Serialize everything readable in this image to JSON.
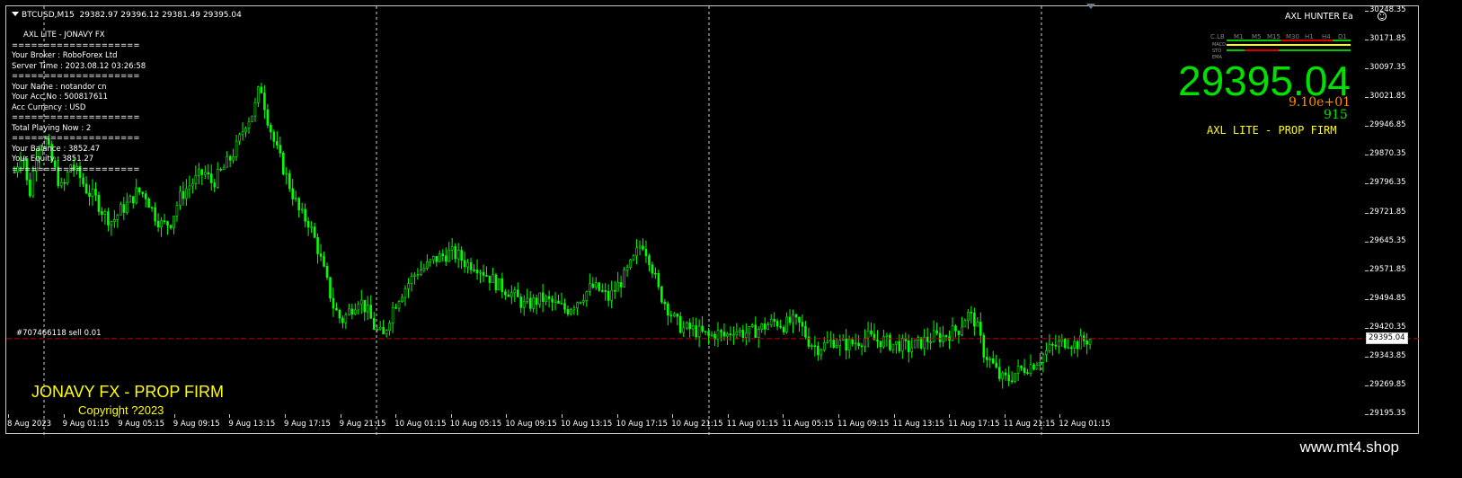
{
  "header": {
    "symbol_timeframe": "BTCUSD,M15",
    "ohlc": "29382.97 29396.12 29381.49 29395.04"
  },
  "info_panel": {
    "title": "AXL LITE - JONAVY FX",
    "separator": "====================",
    "broker": "Your Broker  : RoboForex Ltd",
    "server_time": "Server Time : 2023.08.12 03:26:58",
    "name": "Your Name    : notandor cn",
    "acc_no": "Your Acc.No  : 500817611",
    "currency": "Acc Currency : USD",
    "total_playing": "Total Playing Now : 2",
    "balance": "Your Balance : 3852.47",
    "equity": "Your Equity   : 3851.27"
  },
  "ea": {
    "name": "AXL HUNTER Ea",
    "big_price": "29395.04",
    "sci_value": "9.10e+01",
    "points": "915",
    "label": "AXL LITE  -  PROP FIRM",
    "colors": {
      "price": "#00e000",
      "sci": "#ff8c00",
      "points": "#00e000",
      "label": "#ffff00"
    }
  },
  "tf_panel": {
    "timeframes": [
      "C.LB",
      "M1",
      "M5",
      "M15",
      "M30",
      "H1",
      "H4",
      "D1"
    ],
    "rows": [
      "MACD",
      "STO",
      "EMA"
    ],
    "colors": {
      "up": "#00c800",
      "down": "#d40000",
      "neutral": "#ffff00"
    }
  },
  "order_line": {
    "label": "#707466118 sell 0.01",
    "price": "29395.04",
    "color": "#c80000"
  },
  "footer": {
    "brand": "JONAVY FX - PROP FIRM",
    "copyright": "Copyright ?2023"
  },
  "watermark": "www.mt4.shop",
  "y_axis": {
    "min": 29195.35,
    "max": 30248.35,
    "ticks": [
      "30248.35",
      "30171.85",
      "30097.35",
      "30021.85",
      "29946.85",
      "29870.35",
      "29796.35",
      "29721.85",
      "29645.35",
      "29571.85",
      "29494.85",
      "29420.35",
      "29343.85",
      "29269.85",
      "29195.35"
    ]
  },
  "x_axis": {
    "ticks": [
      "8 Aug 2023",
      "9 Aug 01:15",
      "9 Aug 05:15",
      "9 Aug 09:15",
      "9 Aug 13:15",
      "9 Aug 17:15",
      "9 Aug 21:15",
      "10 Aug 01:15",
      "10 Aug 05:15",
      "10 Aug 09:15",
      "10 Aug 13:15",
      "10 Aug 17:15",
      "10 Aug 21:15",
      "11 Aug 01:15",
      "11 Aug 05:15",
      "11 Aug 09:15",
      "11 Aug 13:15",
      "11 Aug 17:15",
      "11 Aug 21:15",
      "12 Aug 01:15"
    ],
    "day_separators": [
      "9 Aug",
      "10 Aug",
      "11 Aug",
      "12 Aug"
    ]
  },
  "chart_data": {
    "type": "candlestick",
    "symbol": "BTCUSD",
    "timeframe": "M15",
    "candle_color": "#00ff00",
    "grid": false,
    "ylim": [
      29195.35,
      30248.35
    ],
    "close_path": [
      [
        0,
        29830
      ],
      [
        8,
        29890
      ],
      [
        14,
        29760
      ],
      [
        22,
        29900
      ],
      [
        30,
        29910
      ],
      [
        38,
        29840
      ],
      [
        46,
        29780
      ],
      [
        54,
        29850
      ],
      [
        62,
        29820
      ],
      [
        70,
        29780
      ],
      [
        78,
        29760
      ],
      [
        86,
        29720
      ],
      [
        94,
        29700
      ],
      [
        102,
        29730
      ],
      [
        110,
        29750
      ],
      [
        118,
        29780
      ],
      [
        126,
        29770
      ],
      [
        134,
        29720
      ],
      [
        142,
        29690
      ],
      [
        150,
        29700
      ],
      [
        158,
        29760
      ],
      [
        166,
        29790
      ],
      [
        174,
        29810
      ],
      [
        182,
        29830
      ],
      [
        190,
        29800
      ],
      [
        198,
        29830
      ],
      [
        206,
        29860
      ],
      [
        214,
        29900
      ],
      [
        222,
        29960
      ],
      [
        230,
        29990
      ],
      [
        236,
        30060
      ],
      [
        242,
        29980
      ],
      [
        250,
        29900
      ],
      [
        258,
        29840
      ],
      [
        266,
        29780
      ],
      [
        274,
        29720
      ],
      [
        282,
        29700
      ],
      [
        290,
        29640
      ],
      [
        298,
        29560
      ],
      [
        306,
        29480
      ],
      [
        314,
        29440
      ],
      [
        322,
        29470
      ],
      [
        330,
        29500
      ],
      [
        338,
        29470
      ],
      [
        346,
        29420
      ],
      [
        354,
        29400
      ],
      [
        362,
        29470
      ],
      [
        370,
        29510
      ],
      [
        378,
        29540
      ],
      [
        386,
        29570
      ],
      [
        394,
        29580
      ],
      [
        402,
        29600
      ],
      [
        410,
        29610
      ],
      [
        418,
        29620
      ],
      [
        426,
        29610
      ],
      [
        434,
        29590
      ],
      [
        442,
        29590
      ],
      [
        450,
        29570
      ],
      [
        458,
        29550
      ],
      [
        466,
        29530
      ],
      [
        474,
        29520
      ],
      [
        482,
        29500
      ],
      [
        490,
        29480
      ],
      [
        498,
        29490
      ],
      [
        506,
        29500
      ],
      [
        514,
        29490
      ],
      [
        522,
        29480
      ],
      [
        530,
        29470
      ],
      [
        538,
        29490
      ],
      [
        546,
        29510
      ],
      [
        554,
        29530
      ],
      [
        562,
        29520
      ],
      [
        570,
        29500
      ],
      [
        578,
        29530
      ],
      [
        586,
        29560
      ],
      [
        594,
        29600
      ],
      [
        602,
        29650
      ],
      [
        610,
        29600
      ],
      [
        618,
        29520
      ],
      [
        626,
        29480
      ],
      [
        634,
        29440
      ],
      [
        642,
        29420
      ],
      [
        650,
        29420
      ],
      [
        658,
        29410
      ],
      [
        666,
        29400
      ],
      [
        674,
        29410
      ],
      [
        682,
        29400
      ],
      [
        690,
        29420
      ],
      [
        698,
        29410
      ],
      [
        706,
        29410
      ],
      [
        714,
        29420
      ],
      [
        722,
        29430
      ],
      [
        730,
        29440
      ],
      [
        738,
        29430
      ],
      [
        746,
        29440
      ],
      [
        754,
        29430
      ],
      [
        762,
        29390
      ],
      [
        770,
        29370
      ],
      [
        778,
        29380
      ],
      [
        786,
        29390
      ],
      [
        794,
        29380
      ],
      [
        802,
        29380
      ],
      [
        810,
        29390
      ],
      [
        818,
        29400
      ],
      [
        826,
        29390
      ],
      [
        834,
        29390
      ],
      [
        842,
        29380
      ],
      [
        850,
        29380
      ],
      [
        858,
        29370
      ],
      [
        866,
        29380
      ],
      [
        874,
        29390
      ],
      [
        882,
        29400
      ],
      [
        890,
        29400
      ],
      [
        898,
        29410
      ],
      [
        906,
        29420
      ],
      [
        914,
        29460
      ],
      [
        922,
        29440
      ],
      [
        930,
        29360
      ],
      [
        938,
        29330
      ],
      [
        946,
        29290
      ],
      [
        954,
        29290
      ],
      [
        962,
        29310
      ],
      [
        970,
        29320
      ],
      [
        978,
        29330
      ],
      [
        986,
        29350
      ],
      [
        994,
        29370
      ],
      [
        1002,
        29380
      ],
      [
        1010,
        29390
      ],
      [
        1018,
        29380
      ],
      [
        1026,
        29390
      ],
      [
        1034,
        29395
      ]
    ],
    "last_price": 29395.04
  }
}
